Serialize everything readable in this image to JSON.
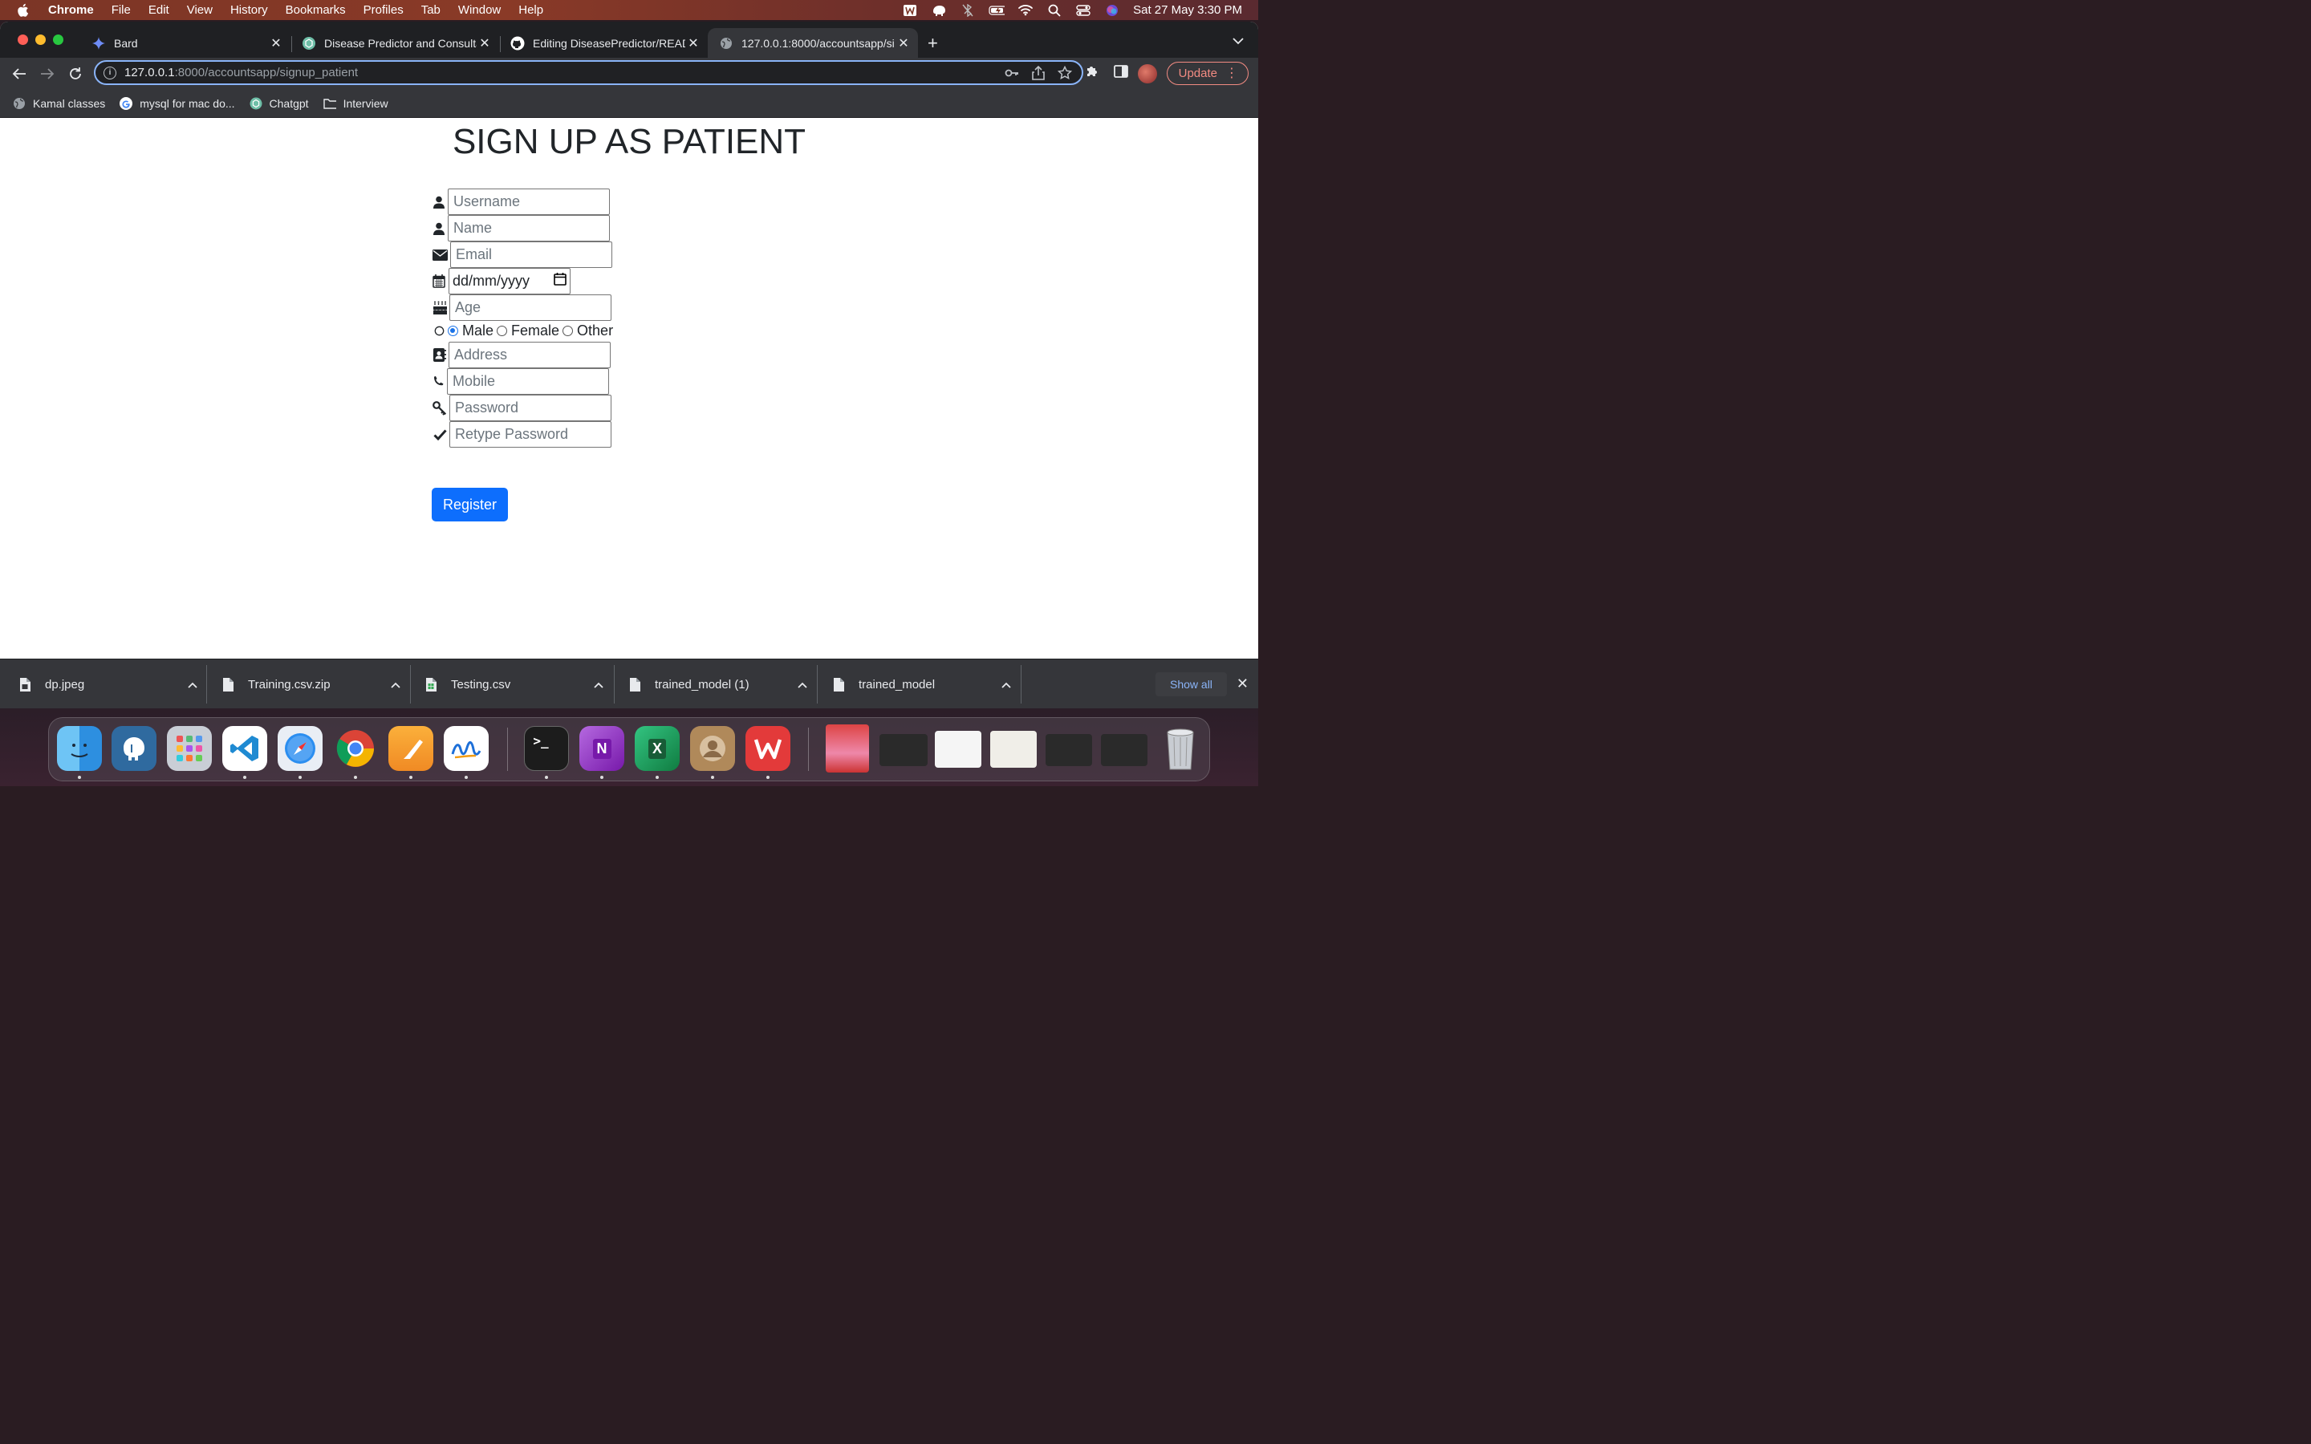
{
  "menubar": {
    "app_name": "Chrome",
    "items": [
      "File",
      "Edit",
      "View",
      "History",
      "Bookmarks",
      "Profiles",
      "Tab",
      "Window",
      "Help"
    ],
    "clock": "Sat 27 May  3:30 PM"
  },
  "tabs": [
    {
      "title": "Bard",
      "icon": "bard-sparkle-icon"
    },
    {
      "title": "Disease Predictor and Consulta",
      "icon": "chatgpt-icon"
    },
    {
      "title": "Editing DiseasePredictor/READ",
      "icon": "github-icon"
    },
    {
      "title": "127.0.0.1:8000/accountsapp/si",
      "icon": "globe-icon"
    }
  ],
  "address_bar": {
    "host": "127.0.0.1",
    "rest": ":8000/accountsapp/signup_patient"
  },
  "toolbar": {
    "update_label": "Update"
  },
  "bookmarks": [
    {
      "label": "Kamal classes",
      "icon": "globe-icon"
    },
    {
      "label": "mysql for mac do...",
      "icon": "google-icon"
    },
    {
      "label": "Chatgpt",
      "icon": "chatgpt-icon"
    },
    {
      "label": "Interview",
      "icon": "folder-icon"
    }
  ],
  "form": {
    "heading": "SIGN UP AS PATIENT",
    "username_placeholder": "Username",
    "name_placeholder": "Name",
    "email_placeholder": "Email",
    "dob_value": "dd/mm/yyyy",
    "age_placeholder": "Age",
    "gender_options": [
      "Male",
      "Female",
      "Other"
    ],
    "gender_selected": "Male",
    "address_placeholder": "Address",
    "mobile_placeholder": "Mobile",
    "password_placeholder": "Password",
    "retype_placeholder": "Retype Password",
    "register_label": "Register",
    "accent_color": "#0d6efd"
  },
  "downloads": {
    "items": [
      "dp.jpeg",
      "Training.csv.zip",
      "Testing.csv",
      "trained_model (1)",
      "trained_model"
    ],
    "show_all_label": "Show all"
  },
  "dock": {
    "apps": [
      "finder-icon",
      "postgres-elephant-icon",
      "launchpad-icon",
      "vscode-icon",
      "safari-icon",
      "chrome-icon",
      "pages-icon",
      "freeform-icon",
      "terminal-icon",
      "onenote-icon",
      "excel-icon",
      "contacts-icon",
      "wps-icon",
      "photo-thumbnail",
      "window-thumbnail-1",
      "window-thumbnail-2",
      "window-thumbnail-3",
      "window-thumbnail-4",
      "window-thumbnail-5",
      "trash-icon"
    ]
  }
}
